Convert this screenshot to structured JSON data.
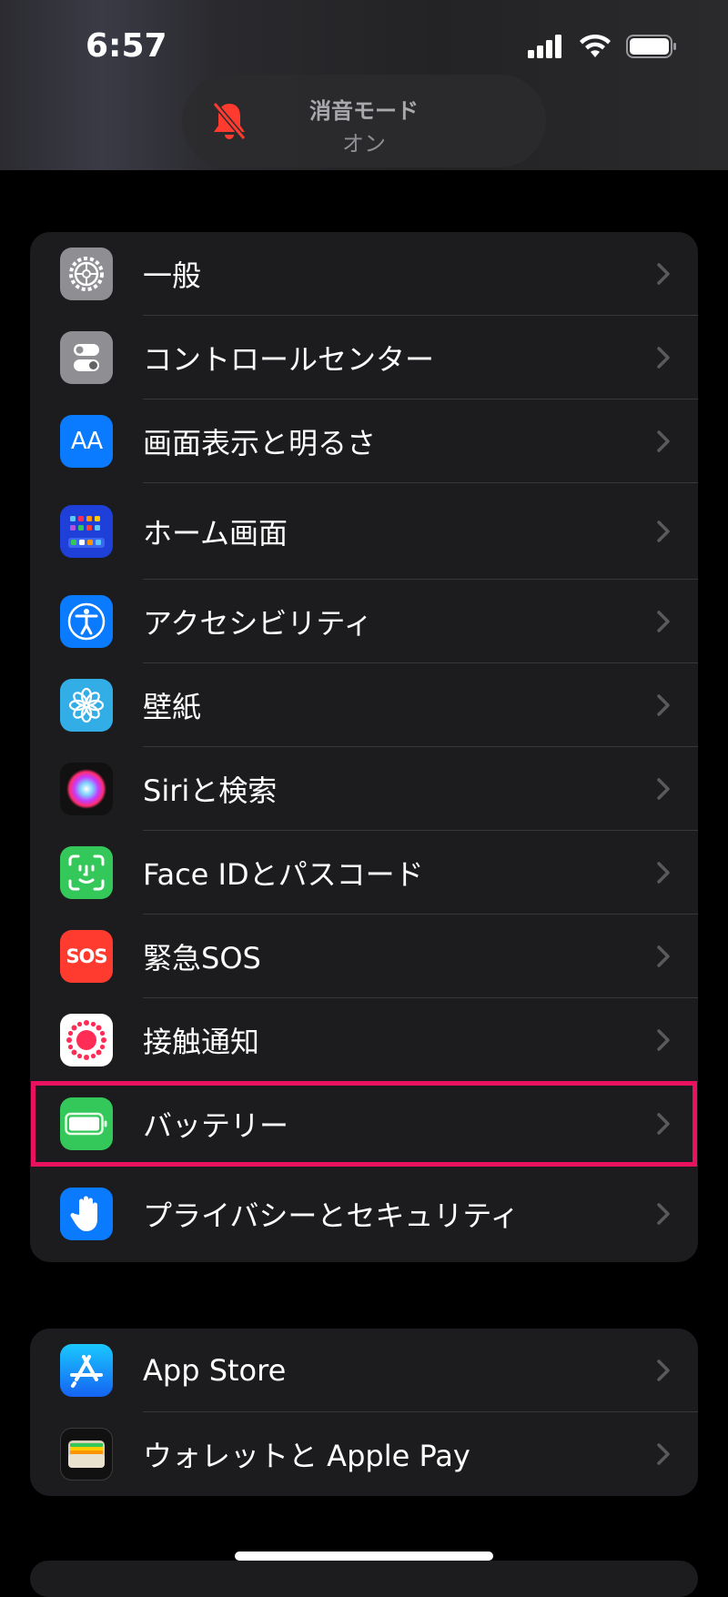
{
  "status_bar": {
    "time": "6:57"
  },
  "silent_banner": {
    "title": "消音モード",
    "subtitle": "オン"
  },
  "groups": [
    {
      "items": [
        {
          "label": "一般"
        },
        {
          "label": "コントロールセンター"
        },
        {
          "label": "画面表示と明るさ",
          "icon_text": "AA"
        },
        {
          "label": "ホーム画面"
        },
        {
          "label": "アクセシビリティ"
        },
        {
          "label": "壁紙"
        },
        {
          "label": "Siriと検索"
        },
        {
          "label": "Face IDとパスコード"
        },
        {
          "label": "緊急SOS",
          "icon_text": "SOS"
        },
        {
          "label": "接触通知"
        },
        {
          "label": "バッテリー",
          "highlighted": true
        },
        {
          "label": "プライバシーとセキュリティ"
        }
      ]
    },
    {
      "items": [
        {
          "label": "App Store"
        },
        {
          "label": "ウォレットと Apple Pay"
        }
      ]
    }
  ],
  "colors": {
    "background": "#000000",
    "cell": "#1c1c1e",
    "separator": "#38383a",
    "highlight": "#e8125e",
    "chevron": "#5a5a5e"
  }
}
